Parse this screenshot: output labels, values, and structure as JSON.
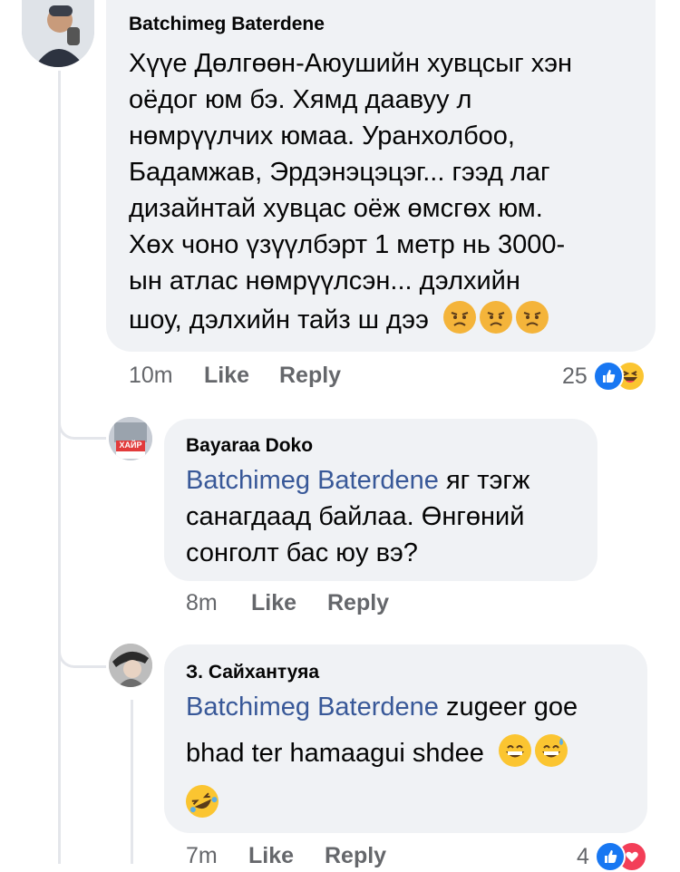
{
  "comments": [
    {
      "author": "Batchimeg Baterdene",
      "lines": [
        "Хүүе Дөлгөөн-Аюушийн хувцсыг хэн",
        "оёдог юм бэ. Хямд даавуу л",
        "нөмрүүлчих юмаа. Уранхолбоо,",
        "Бадамжав, Эрдэнэцэцэг... гээд лаг",
        "дизайнтай хувцас оёж өмсгөх юм.",
        "Хөх чоно үзүүлбэрт 1 метр нь  3000-",
        "ын атлас нөмрүүлсэн... дэлхийн",
        "шоу, дэлхийн тайз ш дээ"
      ],
      "emojis": [
        "angry-face",
        "angry-face",
        "angry-face"
      ],
      "time": "10m",
      "like": "Like",
      "reply": "Reply",
      "reaction_count": "25",
      "reactions": [
        "like",
        "haha"
      ]
    },
    {
      "author": "Bayaraa Doko",
      "mention": "Batchimeg Baterdene",
      "line1_rest": " яг тэгж",
      "line2": "санагдаад байлаа. Өнгөний",
      "line3": "сонголт бас юу вэ?",
      "time": "8m",
      "like": "Like",
      "reply": "Reply",
      "avatar_text": "ХАЙР"
    },
    {
      "author": "З. Сайхантуяа",
      "mention": "Batchimeg Baterdene",
      "line1_rest": " zugeer goe",
      "line2": "bhad ter hamaagui shdee",
      "emojis": [
        "grinning-face",
        "sweat-smile-face",
        "rofl-face"
      ],
      "time": "7m",
      "like": "Like",
      "reply": "Reply",
      "reaction_count": "4",
      "reactions": [
        "like",
        "love"
      ]
    }
  ],
  "colors": {
    "bubble": "#f0f2f5",
    "mention": "#385898",
    "meta": "#65676b",
    "like_blue": "#1877f2",
    "love_red": "#f33e58",
    "emoji_yellow": "#fbc531"
  }
}
